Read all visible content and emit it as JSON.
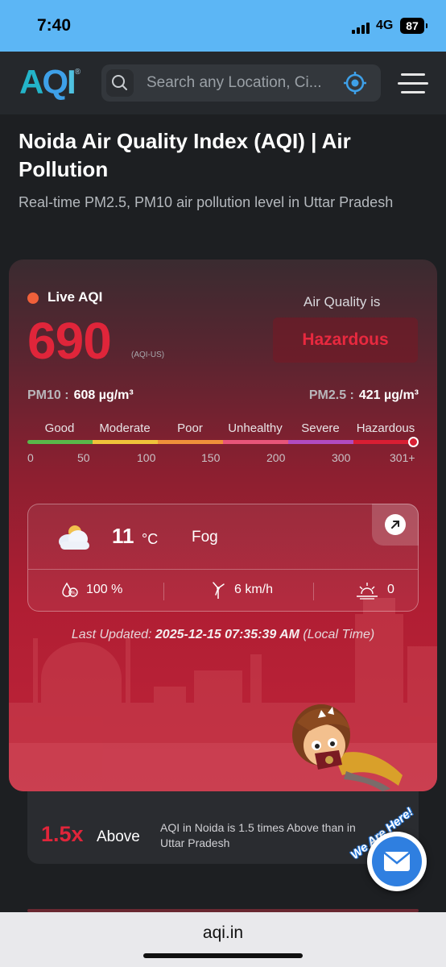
{
  "status_bar": {
    "time": "7:40",
    "network": "4G",
    "battery": "87"
  },
  "header": {
    "logo": {
      "a": "A",
      "q": "Q",
      "i": "I",
      "reg": "®"
    },
    "search": {
      "placeholder": "Search any Location, Ci..."
    },
    "icons": [
      "search-icon",
      "locate-icon",
      "menu-icon"
    ]
  },
  "page": {
    "title": "Noida Air Quality Index (AQI) | Air Pollution",
    "subtitle": "Real-time PM2.5, PM10 air pollution level in Uttar Pradesh"
  },
  "aqi": {
    "live_label": "Live AQI",
    "value": "690",
    "unit": "(AQI-US)",
    "air_quality_is_label": "Air Quality is",
    "status": "Hazardous",
    "pm10_label": "PM10 :",
    "pm10_value": "608 µg/m³",
    "pm25_label": "PM2.5 :",
    "pm25_value": "421 µg/m³",
    "status_color": "#e0253a"
  },
  "scale": {
    "labels": [
      "Good",
      "Moderate",
      "Poor",
      "Unhealthy",
      "Severe",
      "Hazardous"
    ],
    "ticks": [
      "0",
      "50",
      "100",
      "150",
      "200",
      "300",
      "301+"
    ],
    "colors": [
      "#59b84a",
      "#f0c33a",
      "#f0903a",
      "#e8557a",
      "#b14bc0",
      "#d81e33"
    ],
    "marker_level": 1.0
  },
  "weather": {
    "temperature": "11",
    "temperature_unit": "°C",
    "condition": "Fog",
    "humidity": "100 %",
    "wind": "6 km/h",
    "uv": "0",
    "icons": [
      "cloud-icon",
      "expand-arrow-icon",
      "humidity-icon",
      "wind-icon",
      "uv-icon"
    ]
  },
  "last_updated": {
    "label": "Last Updated:",
    "value": "2025-12-15 07:35:39 AM",
    "suffix": "(Local Time)"
  },
  "comparison": {
    "multiplier": "1.5x",
    "word": "Above",
    "text": "AQI in Noida is 1.5 times Above than in Uttar Pradesh"
  },
  "contact_badge": {
    "text": "We Are Here!"
  },
  "browser": {
    "url": "aqi.in"
  }
}
